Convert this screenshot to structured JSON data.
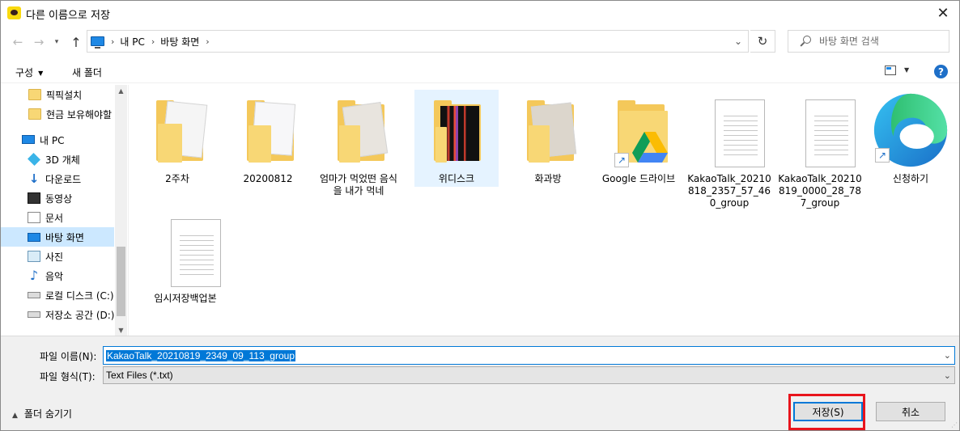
{
  "window": {
    "title": "다른 이름으로 저장",
    "close_glyph": "✕"
  },
  "nav": {
    "back_glyph": "←",
    "forward_glyph": "→",
    "recent_glyph": "▾",
    "up_glyph": "↑",
    "breadcrumb": [
      "내 PC",
      "바탕 화면"
    ],
    "separator": "›",
    "dropdown_glyph": "⌄",
    "refresh_glyph": "↻",
    "search_placeholder": "바탕 화면 검색"
  },
  "toolbar": {
    "organize_label": "구성",
    "new_folder_label": "새 폴더",
    "help_label": "?",
    "caret": "▼"
  },
  "sidebar": {
    "items": [
      {
        "label": "픽픽설치",
        "icon": "folder-icon"
      },
      {
        "label": "현금 보유해야할",
        "icon": "folder-icon"
      },
      {
        "label": "내 PC",
        "icon": "computer-icon"
      },
      {
        "label": "3D 개체",
        "icon": "cube-icon"
      },
      {
        "label": "다운로드",
        "icon": "download-icon"
      },
      {
        "label": "동영상",
        "icon": "video-icon"
      },
      {
        "label": "문서",
        "icon": "document-icon"
      },
      {
        "label": "바탕 화면",
        "icon": "desktop-icon",
        "selected": true
      },
      {
        "label": "사진",
        "icon": "pictures-icon"
      },
      {
        "label": "음악",
        "icon": "music-icon"
      },
      {
        "label": "로컬 디스크 (C:)",
        "icon": "drive-icon"
      },
      {
        "label": "저장소 공간 (D:)",
        "icon": "drive-icon"
      }
    ],
    "scroll_up": "▲",
    "scroll_down": "▼"
  },
  "files": [
    {
      "name": "2주차",
      "type": "folder"
    },
    {
      "name": "20200812",
      "type": "folder"
    },
    {
      "name": "엄마가 먹었떤 음식을 내가 먹네",
      "type": "folder"
    },
    {
      "name": "위디스크",
      "type": "folder",
      "selected": true
    },
    {
      "name": "화과방",
      "type": "folder"
    },
    {
      "name": "Google 드라이브",
      "type": "folder-shortcut"
    },
    {
      "name": "KakaoTalk_20210818_2357_57_460_group",
      "type": "text-file"
    },
    {
      "name": "KakaoTalk_20210819_0000_28_787_group",
      "type": "text-file"
    },
    {
      "name": "신청하기",
      "type": "edge-shortcut"
    },
    {
      "name": "임시저장백업본",
      "type": "text-file"
    }
  ],
  "form": {
    "filename_label": "파일 이름(N):",
    "filename_value": "KakaoTalk_20210819_2349_09_113_group",
    "filetype_label": "파일 형식(T):",
    "filetype_value": "Text Files (*.txt)",
    "hide_folders_label": "폴더 숨기기",
    "save_label": "저장(S)",
    "cancel_label": "취소",
    "dropdown_glyph": "⌄",
    "hide_caret": "▲"
  },
  "colors": {
    "accent": "#0078d7",
    "selection": "#cce8ff",
    "highlight_box": "#e8141c"
  }
}
